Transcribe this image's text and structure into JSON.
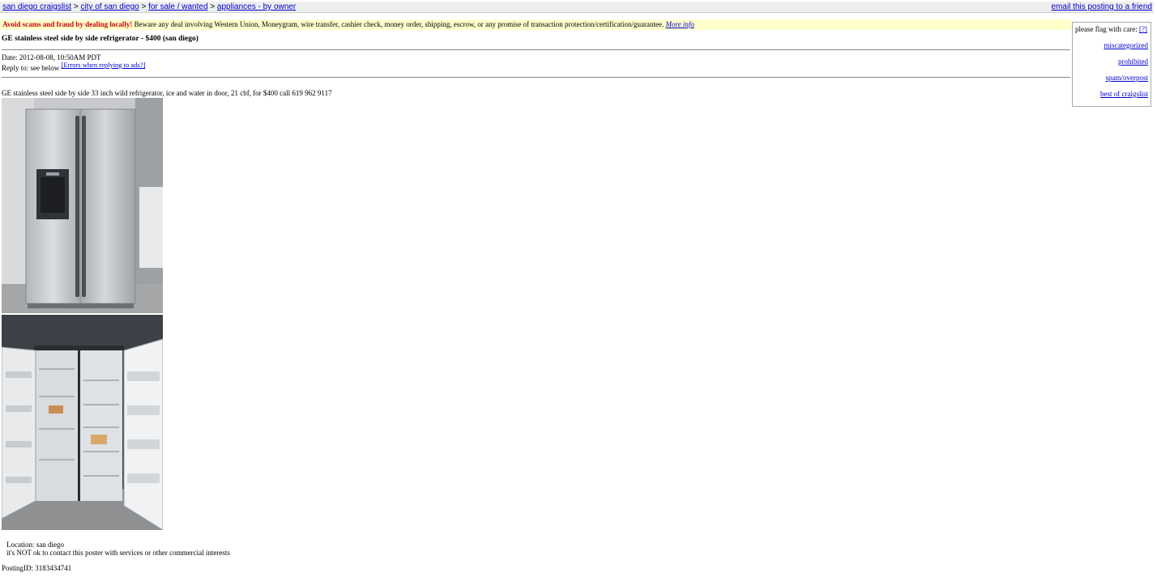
{
  "breadcrumb": {
    "items": [
      "san diego craigslist",
      "city of san diego",
      "for sale / wanted",
      "appliances - by owner"
    ],
    "separator": ">"
  },
  "email_link": "email this posting to a friend",
  "flag": {
    "title": "please flag with care:",
    "help": "[?]",
    "options": [
      "miscategorized",
      "prohibited",
      "spam/overpost",
      "best of craigslist"
    ]
  },
  "scam_notice": {
    "warning": "Avoid scams and fraud by dealing locally!",
    "text": " Beware any deal involving Western Union, Moneygram, wire transfer, cashier check, money order, shipping, escrow, or any promise of transaction protection/certification/guarantee. ",
    "more_info": "More info"
  },
  "posting": {
    "title": "GE stainless steel side by side refrigerator - $400 (san diego)",
    "date": "Date: 2012-08-08, 10:50AM PDT",
    "reply_to": "Reply to: see below",
    "reply_errors": "[Errors when replying to ads?]",
    "body": "GE stainless steel side by side 33 inch wild refrigerator, ice and water in door, 21 cbf, for $400 call 619 962 9117",
    "location": "Location: san diego",
    "contact_notice": "it's NOT ok to contact this poster with services or other commercial interests",
    "posting_id": "PostingID: 3183434741"
  },
  "colors": {
    "link": "#0000cc",
    "scam_bg": "#ffffcc",
    "scam_warning": "#cc0000",
    "topbar_bg": "#eeeeee"
  }
}
